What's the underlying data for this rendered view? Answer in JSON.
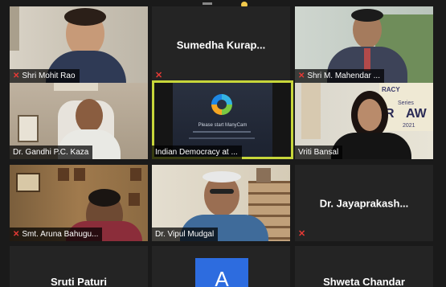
{
  "participants": [
    {
      "name": "Shri Mohit Rao",
      "muted": true
    },
    {
      "name": "Sumedha  Kurap...",
      "muted": true
    },
    {
      "name": "Shri M. Mahendar ...",
      "muted": true
    },
    {
      "name": "Dr. Gandhi  P.C. Kaza",
      "muted": false
    },
    {
      "name": "Indian Democracy at ...",
      "muted": false,
      "screen_text": "Please start ManyCam"
    },
    {
      "name": "Vriti Bansal",
      "muted": false,
      "backdrop_text": [
        "RACY",
        "Series",
        "R",
        "AW",
        "2021"
      ]
    },
    {
      "name": "Smt. Aruna Bahugu...",
      "muted": true
    },
    {
      "name": "Dr. Vipul Mudgal",
      "muted": false
    },
    {
      "name": "Dr.  Jayaprakash...",
      "muted": true
    },
    {
      "name": "Sruti Paturi",
      "muted": false
    },
    {
      "name": "A",
      "muted": false
    },
    {
      "name": "Shweta Chandar",
      "muted": false
    }
  ],
  "icons": {
    "mute": "microphone-muted-icon"
  },
  "colors": {
    "active_border": "#c7d63a",
    "mute": "#e53935",
    "tile_bg": "#262626",
    "avatar_bg": "#2d6cdf"
  }
}
